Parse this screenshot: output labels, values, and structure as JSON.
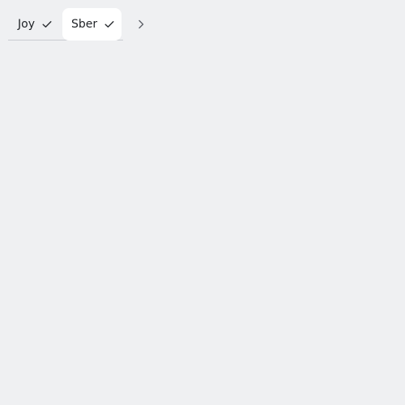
{
  "tabs": [
    {
      "label": "Joy",
      "status_icon": "check-icon"
    },
    {
      "label": "Sber",
      "status_icon": "check-icon",
      "active": true
    }
  ],
  "navigation": {
    "next_icon": "chevron-right-icon"
  },
  "colors": {
    "background": "#eff0f2",
    "active_tab": "#ffffff",
    "text": "#1f2226",
    "icon": "#5d6168",
    "divider": "#c9ccd1"
  }
}
